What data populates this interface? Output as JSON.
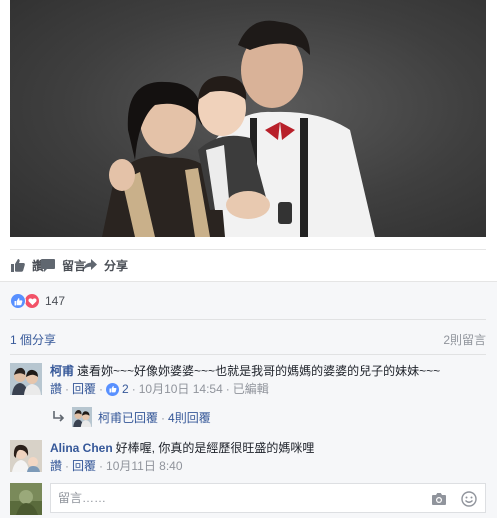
{
  "actions": {
    "like_label": "讚",
    "comment_label": "留言",
    "share_label": "分享"
  },
  "reactions": {
    "count": "147",
    "types": [
      "like",
      "love"
    ]
  },
  "summary": {
    "shares": "1 個分享",
    "comments": "2則留言"
  },
  "comments": [
    {
      "author": "柯甫",
      "text": "遠看妳~~~好像妳婆婆~~~也就是我哥的媽媽的婆婆的兒子的妹妹~~~",
      "like": "讚",
      "reply": "回覆",
      "like_count": "2",
      "time": "10月10日 14:54",
      "edited": "已編輯"
    },
    {
      "author": "Alina Chen",
      "text": "好棒喔, 你真的是經歷很旺盛的媽咪哩",
      "like": "讚",
      "reply": "回覆",
      "time": "10月11日 8:40"
    }
  ],
  "reply_summary": {
    "replied": "柯甫已回覆",
    "count": "4則回覆"
  },
  "composer": {
    "placeholder": "留言……"
  },
  "icons": {
    "like": "thumbs-up-icon",
    "comment": "speech-bubble-icon",
    "share": "share-arrow-icon",
    "camera": "camera-icon",
    "emoji": "smiley-icon"
  },
  "colors": {
    "link": "#365899",
    "like_blue": "#5890ff",
    "love_red": "#f25268",
    "meta_gray": "#90949c"
  }
}
